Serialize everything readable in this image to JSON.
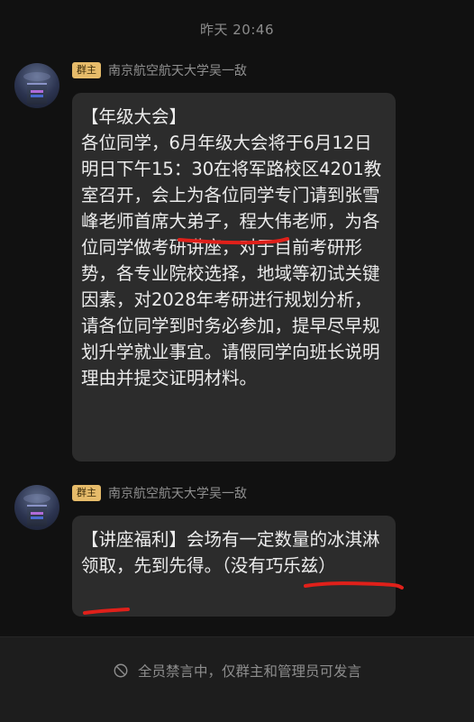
{
  "timestamp": "昨天 20:46",
  "messages": [
    {
      "role_badge": "群主",
      "sender": "南京航空航天大学吴一敌",
      "text": "【年级大会】\n各位同学，6月年级大会将于6月12日明日下午15：30在将军路校区4201教室召开，会上为各位同学专门请到张雪峰老师首席大弟子，程大伟老师，为各位同学做考研讲座，对于目前考研形势，各专业院校选择，地域等初试关键因素，对2028年考研进行规划分析，请各位同学到时务必参加，提早尽早规划升学就业事宜。请假同学向班长说明理由并提交证明材料。"
    },
    {
      "role_badge": "群主",
      "sender": "南京航空航天大学吴一敌",
      "text": "【讲座福利】会场有一定数量的冰淇淋领取，先到先得。（没有巧乐兹）"
    }
  ],
  "footer": {
    "mute_text": "全员禁言中，仅群主和管理员可发言",
    "icon": "mute-icon"
  },
  "colors": {
    "background": "#111111",
    "bubble": "#2c2c2c",
    "badge": "#e6bb6a",
    "annotation": "#e0201a"
  }
}
